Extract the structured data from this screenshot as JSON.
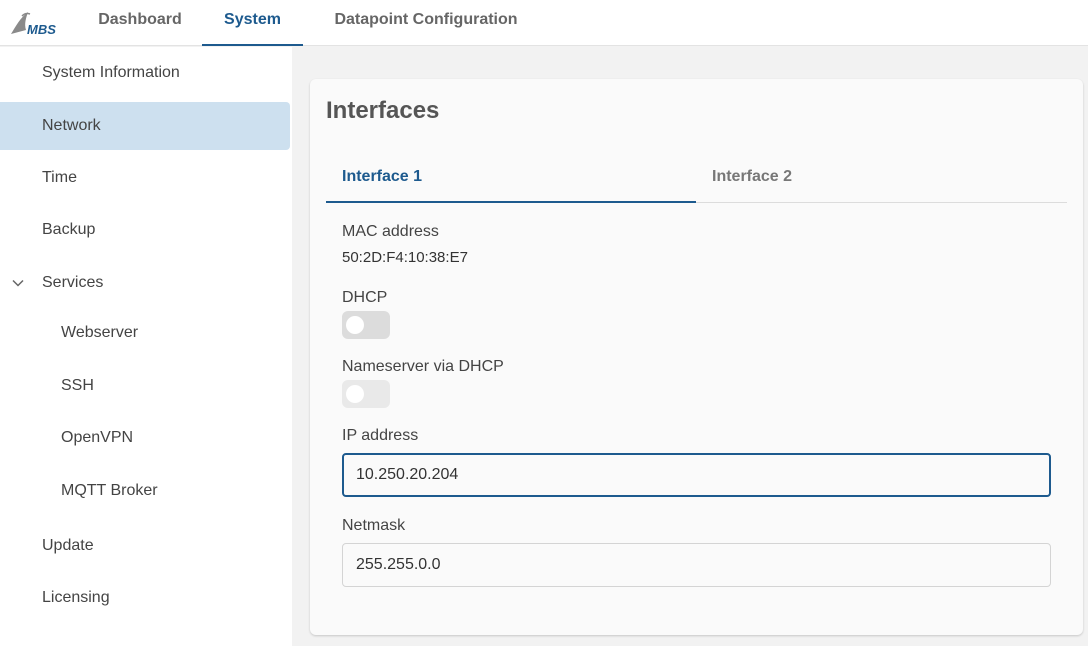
{
  "header": {
    "logo_text": "MBS",
    "tabs": [
      {
        "label": "Dashboard"
      },
      {
        "label": "System"
      },
      {
        "label": "Datapoint Configuration"
      }
    ],
    "active_tab": "System"
  },
  "sidebar": {
    "items": [
      {
        "label": "System Information"
      },
      {
        "label": "Network"
      },
      {
        "label": "Time"
      },
      {
        "label": "Backup"
      },
      {
        "label": "Services"
      },
      {
        "label": "Webserver"
      },
      {
        "label": "SSH"
      },
      {
        "label": "OpenVPN"
      },
      {
        "label": "MQTT Broker"
      },
      {
        "label": "Update"
      },
      {
        "label": "Licensing"
      }
    ],
    "selected": "Network",
    "expanded_group": "Services"
  },
  "main": {
    "title": "Interfaces",
    "tabs": [
      {
        "label": "Interface 1"
      },
      {
        "label": "Interface 2"
      }
    ],
    "active_tab": "Interface 1",
    "mac": {
      "label": "MAC address",
      "value": "50:2D:F4:10:38:E7"
    },
    "dhcp": {
      "label": "DHCP",
      "checked": false
    },
    "nameserver_dhcp": {
      "label": "Nameserver via DHCP",
      "checked": false,
      "disabled": true
    },
    "ip": {
      "label": "IP address",
      "value": "10.250.20.204"
    },
    "netmask": {
      "label": "Netmask",
      "value": "255.255.0.0"
    }
  },
  "colors": {
    "accent": "#1d5a8e",
    "selected_bg": "#cde0ef",
    "page_bg": "#f2f2f2"
  }
}
